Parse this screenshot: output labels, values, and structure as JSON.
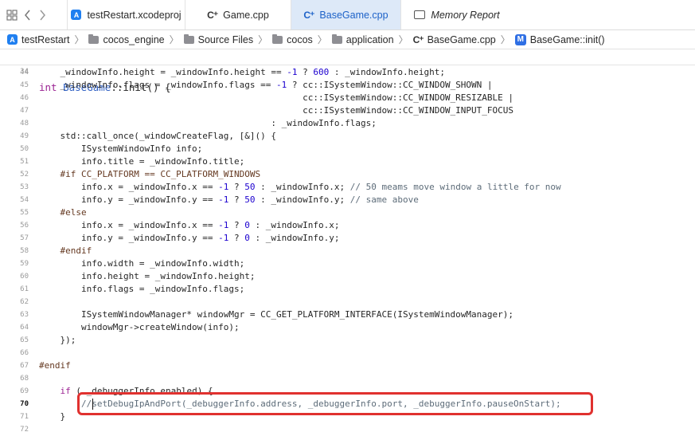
{
  "tabs": [
    {
      "label": "testRestart.xcodeproj",
      "icon": "xcodeproj-icon",
      "active": false
    },
    {
      "label": "Game.cpp",
      "icon": "cpp-file-icon",
      "active": false
    },
    {
      "label": "BaseGame.cpp",
      "icon": "cpp-file-icon",
      "active": true
    },
    {
      "label": "Memory Report",
      "icon": "memory-report-icon",
      "active": false
    }
  ],
  "cpp_icon_glyph": "C⁺",
  "project_icon_glyph": "A",
  "method_icon_glyph": "M",
  "breadcrumb": [
    "testRestart",
    "cocos_engine",
    "Source Files",
    "cocos",
    "application",
    "BaseGame.cpp",
    "BaseGame::init()"
  ],
  "breadcrumb_separator": "〉",
  "colors": {
    "accent": "#1d62c8",
    "highlight_box": "#e0312f",
    "keyword": "#9b2393",
    "number": "#1c00cf",
    "comment": "#5d6c79"
  },
  "sticky_header": {
    "num": "34",
    "text": "int BaseGame::init() {"
  },
  "code_lines": [
    {
      "num": "44",
      "text": "    _windowInfo.height = _windowInfo.height == -1 ? 600 : _windowInfo.height;"
    },
    {
      "num": "45",
      "text": "    _windowInfo.flags = _windowInfo.flags == -1 ? cc::ISystemWindow::CC_WINDOW_SHOWN |"
    },
    {
      "num": "46",
      "text": "                                                  cc::ISystemWindow::CC_WINDOW_RESIZABLE |"
    },
    {
      "num": "47",
      "text": "                                                  cc::ISystemWindow::CC_WINDOW_INPUT_FOCUS"
    },
    {
      "num": "48",
      "text": "                                            : _windowInfo.flags;"
    },
    {
      "num": "49",
      "text": "    std::call_once(_windowCreateFlag, [&]() {"
    },
    {
      "num": "50",
      "text": "        ISystemWindowInfo info;"
    },
    {
      "num": "51",
      "text": "        info.title = _windowInfo.title;"
    },
    {
      "num": "52",
      "text": "    #if CC_PLATFORM == CC_PLATFORM_WINDOWS"
    },
    {
      "num": "53",
      "text": "        info.x = _windowInfo.x == -1 ? 50 : _windowInfo.x; // 50 meams move window a little for now"
    },
    {
      "num": "54",
      "text": "        info.y = _windowInfo.y == -1 ? 50 : _windowInfo.y; // same above"
    },
    {
      "num": "55",
      "text": "    #else"
    },
    {
      "num": "56",
      "text": "        info.x = _windowInfo.x == -1 ? 0 : _windowInfo.x;"
    },
    {
      "num": "57",
      "text": "        info.y = _windowInfo.y == -1 ? 0 : _windowInfo.y;"
    },
    {
      "num": "58",
      "text": "    #endif"
    },
    {
      "num": "59",
      "text": "        info.width = _windowInfo.width;"
    },
    {
      "num": "60",
      "text": "        info.height = _windowInfo.height;"
    },
    {
      "num": "61",
      "text": "        info.flags = _windowInfo.flags;"
    },
    {
      "num": "62",
      "text": ""
    },
    {
      "num": "63",
      "text": "        ISystemWindowManager* windowMgr = CC_GET_PLATFORM_INTERFACE(ISystemWindowManager);"
    },
    {
      "num": "64",
      "text": "        windowMgr->createWindow(info);"
    },
    {
      "num": "65",
      "text": "    });"
    },
    {
      "num": "66",
      "text": ""
    },
    {
      "num": "67",
      "text": "#endif"
    },
    {
      "num": "68",
      "text": ""
    },
    {
      "num": "69",
      "text": "    if ( _debuggerInfo.enabled) {"
    },
    {
      "num": "70",
      "text": "        //setDebugIpAndPort(_debuggerInfo.address, _debuggerInfo.port, _debuggerInfo.pauseOnStart);"
    },
    {
      "num": "71",
      "text": "    }"
    },
    {
      "num": "72",
      "text": ""
    }
  ],
  "current_line": "70"
}
